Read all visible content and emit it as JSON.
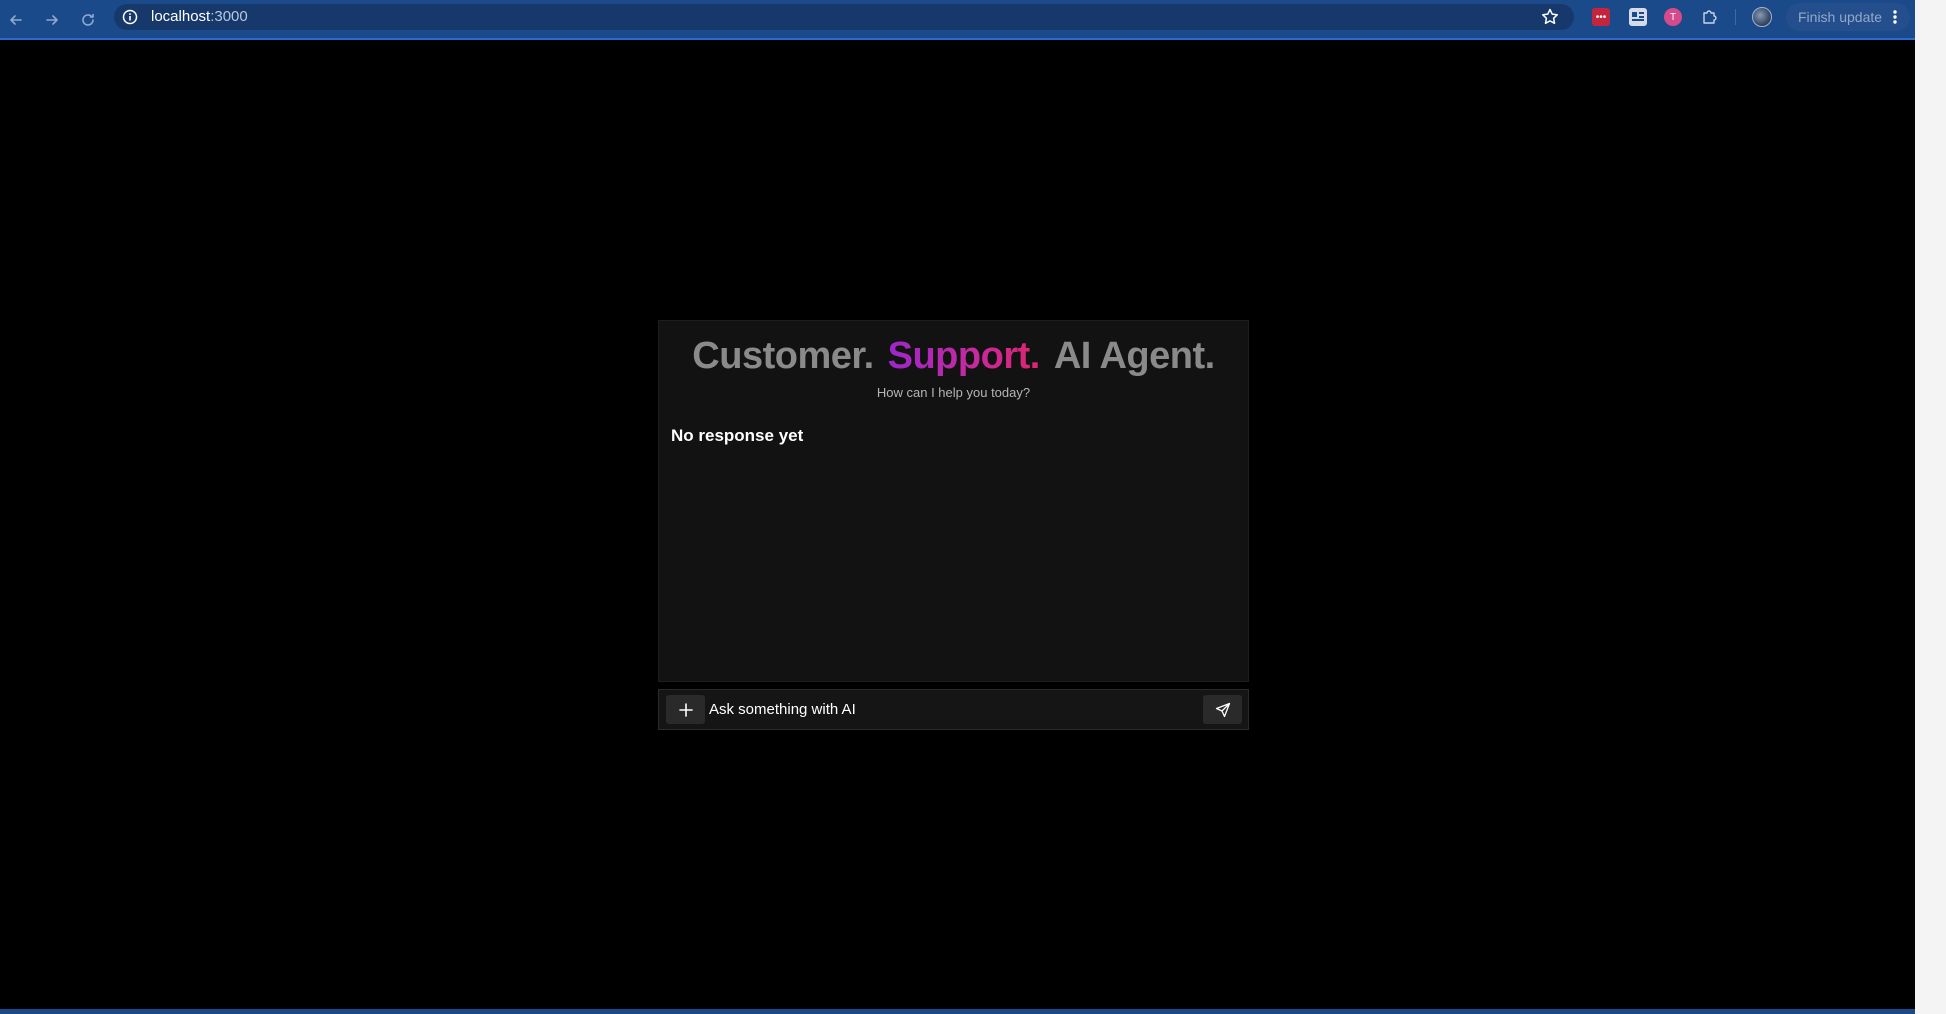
{
  "browser": {
    "url_host": "localhost",
    "url_port": ":3000",
    "finish_update_label": "Finish update",
    "icons": {
      "back": "arrow-left-icon",
      "forward": "arrow-right-icon",
      "reload": "reload-icon",
      "site_info": "info-icon",
      "bookmark": "star-icon",
      "extensions": "puzzle-icon",
      "menu": "more-vertical-icon"
    },
    "colors": {
      "toolbar": "#1b4a8a",
      "omnibox": "#16386a"
    }
  },
  "app": {
    "headline": {
      "word1": "Customer.",
      "word2": "Support.",
      "word3": "AI Agent."
    },
    "subtitle": "How can I help you today?",
    "response_text": "No response yet",
    "input": {
      "placeholder": "Ask something with AI",
      "value": ""
    },
    "icons": {
      "attach": "plus-icon",
      "send": "send-icon"
    },
    "colors": {
      "background": "#000000",
      "card": "#121212",
      "headline_muted": "#8a8a8a",
      "gradient_start": "#9b27c9",
      "gradient_end": "#e0256f"
    }
  }
}
